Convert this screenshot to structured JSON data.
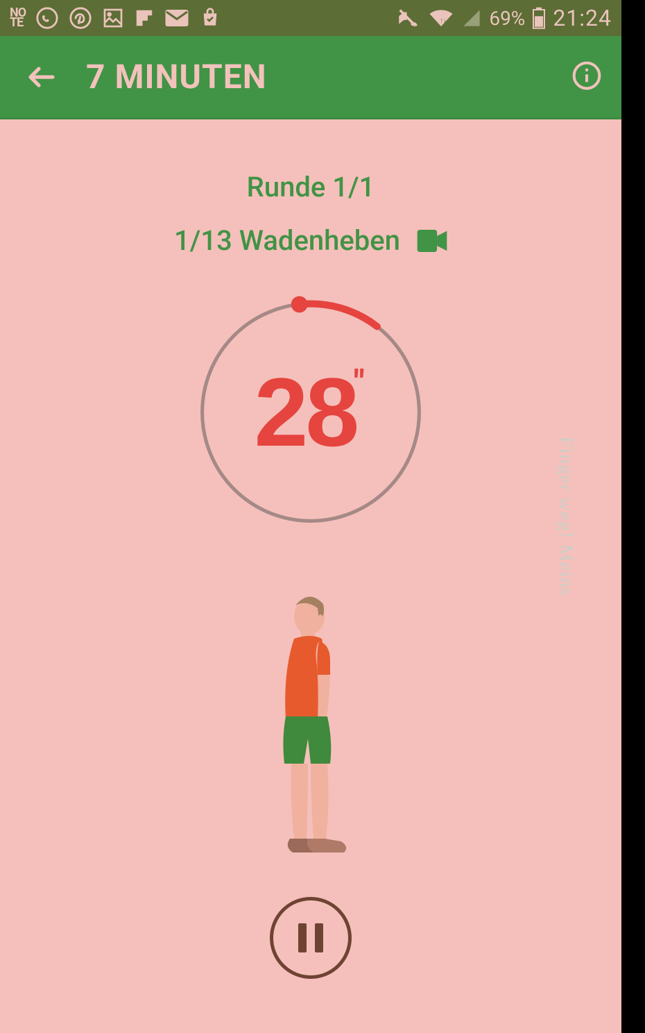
{
  "status": {
    "battery_percent": "69%",
    "clock": "21:24"
  },
  "appbar": {
    "title": "7 MINUTEN"
  },
  "workout": {
    "round_label": "Runde 1/1",
    "exercise_label": "1/13 Wadenheben",
    "timer_seconds": "28",
    "timer_unit": "″",
    "progress_fraction": 0.066
  },
  "watermark": "Finger weg! Meins",
  "colors": {
    "accent_green": "#419346",
    "timer_red": "#e6443f",
    "bg_pink": "#f5c0bb",
    "statusbar": "#5c6d35",
    "iconbeige": "#eac3bb",
    "ring_grey": "#a58986",
    "outline_brown": "#6f4333"
  }
}
